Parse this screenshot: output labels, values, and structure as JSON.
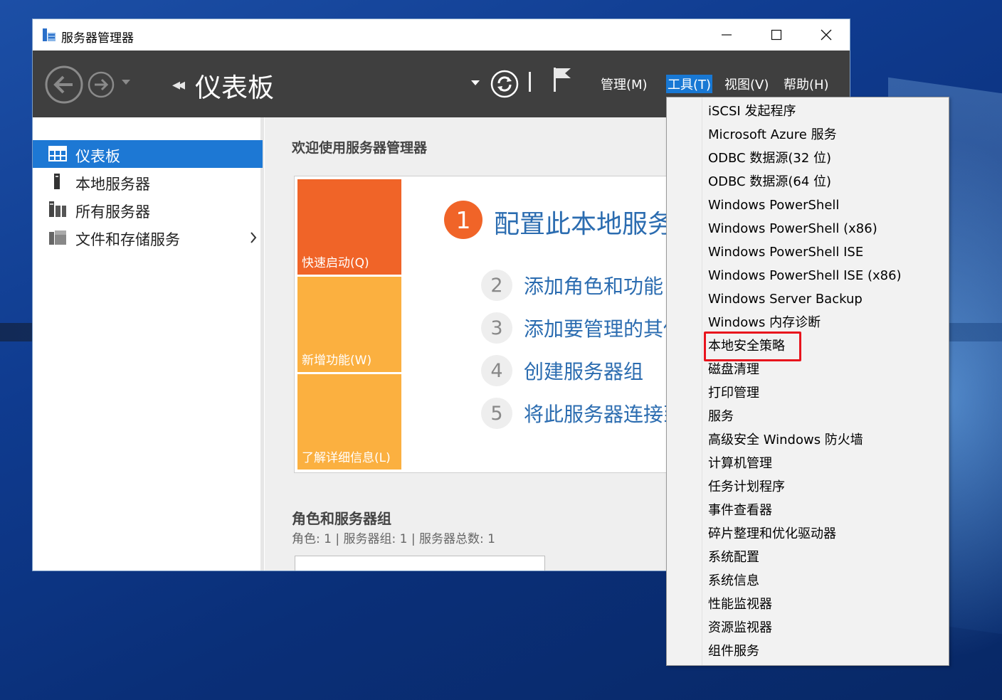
{
  "window": {
    "title": "服务器管理器",
    "controls": {
      "minimize": "minimize-icon",
      "maximize": "maximize-icon",
      "close": "close-icon"
    }
  },
  "header": {
    "breadcrumb_arrows": "◂◂",
    "page_title": "仪表板",
    "menus": [
      "管理(M)",
      "工具(T)",
      "视图(V)",
      "帮助(H)"
    ],
    "active_menu": "工具(T)"
  },
  "sidebar": {
    "items": [
      {
        "label": "仪表板",
        "icon": "dashboard-icon",
        "active": true
      },
      {
        "label": "本地服务器",
        "icon": "server-icon",
        "active": false
      },
      {
        "label": "所有服务器",
        "icon": "servers-icon",
        "active": false
      },
      {
        "label": "文件和存储服务",
        "icon": "storage-icon",
        "active": false,
        "has_submenu": true
      }
    ]
  },
  "main": {
    "welcome": "欢迎使用服务器管理器",
    "tiles": [
      "快速启动(Q)",
      "新增功能(W)",
      "了解详细信息(L)"
    ],
    "step1": {
      "number": "1",
      "text": "配置此本地服务"
    },
    "steps": [
      {
        "number": "2",
        "text": "添加角色和功能"
      },
      {
        "number": "3",
        "text": "添加要管理的其他"
      },
      {
        "number": "4",
        "text": "创建服务器组"
      },
      {
        "number": "5",
        "text": "将此服务器连接到"
      }
    ],
    "roles_title": "角色和服务器组",
    "roles_sub": "角色: 1 | 服务器组: 1 | 服务器总数: 1"
  },
  "tools_menu": {
    "items": [
      "iSCSI 发起程序",
      "Microsoft Azure 服务",
      "ODBC 数据源(32 位)",
      "ODBC 数据源(64 位)",
      "Windows PowerShell",
      "Windows PowerShell (x86)",
      "Windows PowerShell ISE",
      "Windows PowerShell ISE (x86)",
      "Windows Server Backup",
      "Windows 内存诊断",
      "本地安全策略",
      "磁盘清理",
      "打印管理",
      "服务",
      "高级安全 Windows 防火墙",
      "计算机管理",
      "任务计划程序",
      "事件查看器",
      "碎片整理和优化驱动器",
      "系统配置",
      "系统信息",
      "性能监视器",
      "资源监视器",
      "组件服务"
    ],
    "highlighted": "本地安全策略"
  },
  "colors": {
    "header_bg": "#3f3f3f",
    "accent_blue": "#1d78d4",
    "tile_orange": "#f06428",
    "tile_yellow": "#fbb040",
    "link_blue": "#2b6cb0",
    "highlight_red": "#e8141d"
  }
}
